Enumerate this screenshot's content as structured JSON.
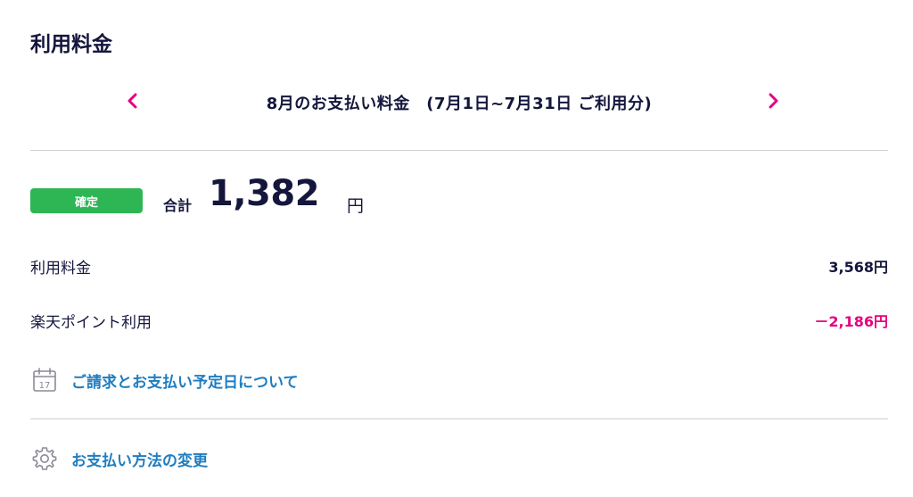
{
  "page": {
    "title": "利用料金"
  },
  "period": {
    "label": "8月のお支払い料金　(7月1日~7月31日 ご利用分)",
    "prev_icon": "chevron-left-icon",
    "next_icon": "chevron-right-icon",
    "accent_color": "#e5007e"
  },
  "total": {
    "status": "確定",
    "status_color": "#2eb554",
    "label": "合計",
    "amount": "1,382",
    "unit": "円"
  },
  "items": [
    {
      "label": "利用料金",
      "value": "3,568円"
    },
    {
      "label": "楽天ポイント利用",
      "value": "－2,186円"
    }
  ],
  "links": {
    "billing": {
      "label": "ご請求とお支払い予定日について",
      "icon": "calendar-icon",
      "calendar_day": "17"
    },
    "payment": {
      "label": "お支払い方法の変更",
      "icon": "gear-icon"
    },
    "link_color": "#1f7dc0"
  }
}
